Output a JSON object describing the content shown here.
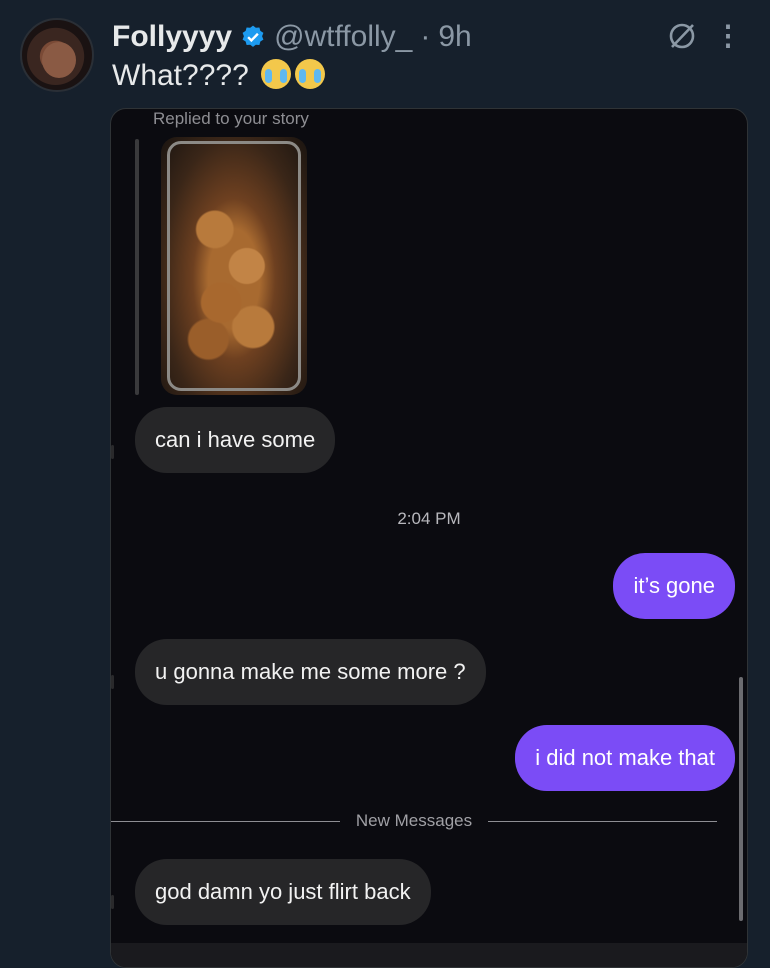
{
  "tweet": {
    "display_name": "Follyyyy",
    "handle": "@wtffolly_",
    "separator": "·",
    "time": "9h",
    "text": "What????",
    "icons": {
      "verified": "verified-badge-icon",
      "grok": "grok-icon",
      "more": "more-options-icon"
    },
    "more_glyph": "⋮",
    "colors": {
      "verified": "#1d9bf0",
      "background": "#16202c"
    }
  },
  "screenshot": {
    "replied_label": "Replied to your story",
    "messages": [
      {
        "from": "them",
        "text": "can i have some"
      },
      {
        "from": "me",
        "text": "it’s gone"
      },
      {
        "from": "them",
        "text": "u gonna make me some more ?"
      },
      {
        "from": "me",
        "text": "i did not make that"
      },
      {
        "from": "them",
        "text": "god damn yo just flirt back"
      }
    ],
    "timestamp": "2:04 PM",
    "new_messages_label": "New Messages",
    "colors": {
      "outgoing": "#7b4cf6",
      "incoming": "#262628"
    }
  }
}
